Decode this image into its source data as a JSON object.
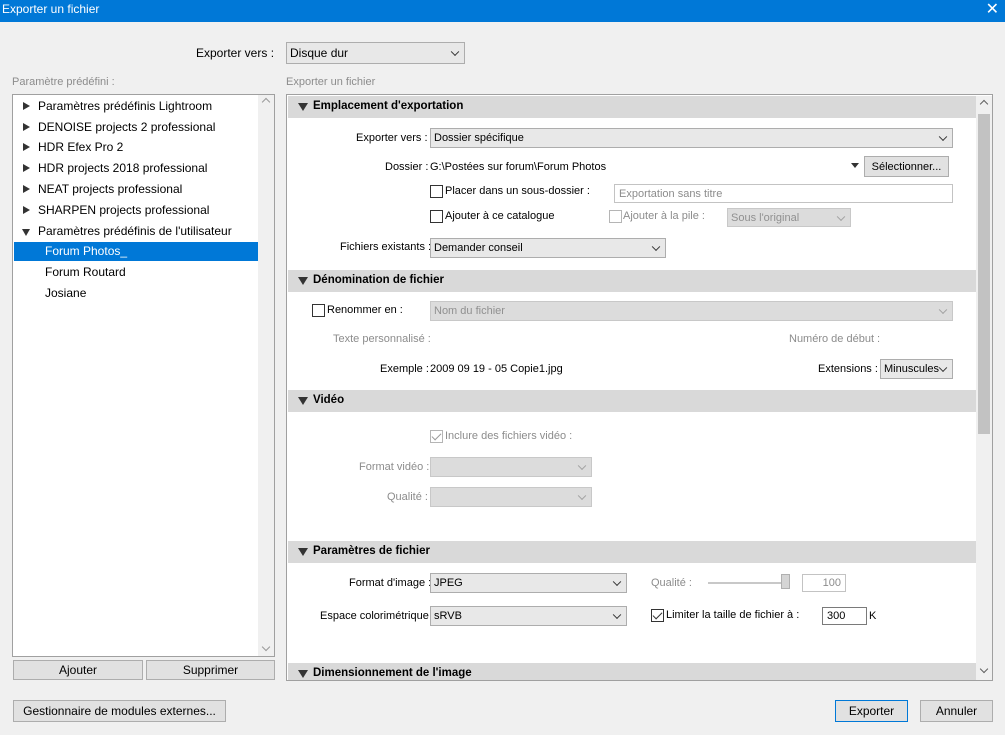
{
  "window": {
    "title": "Exporter un fichier",
    "close": "✕"
  },
  "top": {
    "export_to_label": "Exporter vers :",
    "export_to_value": "Disque dur"
  },
  "left": {
    "header": "Paramètre prédéfini :",
    "presets": [
      "Paramètres prédéfinis Lightroom",
      "DENOISE projects 2 professional",
      "HDR Efex Pro 2",
      "HDR projects 2018 professional",
      "NEAT projects professional",
      "SHARPEN projects professional",
      "Paramètres prédéfinis de l'utilisateur"
    ],
    "user_presets": [
      "Forum Photos_",
      "Forum Routard",
      "Josiane"
    ],
    "add_button": "Ajouter",
    "remove_button": "Supprimer"
  },
  "right": {
    "header": "Exporter un fichier",
    "location": {
      "title": "Emplacement d'exportation",
      "export_to_label": "Exporter vers :",
      "export_to_value": "Dossier spécifique",
      "folder_label": "Dossier :",
      "folder_value": "G:\\Postées sur forum\\Forum Photos",
      "select_button": "Sélectionner...",
      "subfolder_label": "Placer dans un sous-dossier :",
      "subfolder_placeholder": "Exportation sans titre",
      "add_catalog_label": "Ajouter à ce catalogue",
      "add_stack_label": "Ajouter à la pile :",
      "stack_value": "Sous l'original",
      "existing_label": "Fichiers existants :",
      "existing_value": "Demander conseil"
    },
    "naming": {
      "title": "Dénomination de fichier",
      "rename_label": "Renommer en :",
      "rename_value": "Nom du fichier",
      "custom_text_label": "Texte personnalisé :",
      "start_number_label": "Numéro de début :",
      "example_label": "Exemple :",
      "example_value": "2009 09 19 - 05 Copie1.jpg",
      "extensions_label": "Extensions :",
      "extensions_value": "Minuscules"
    },
    "video": {
      "title": "Vidéo",
      "include_label": "Inclure des fichiers vidéo :",
      "format_label": "Format vidéo :",
      "quality_label": "Qualité :"
    },
    "file_settings": {
      "title": "Paramètres de fichier",
      "format_label": "Format d'image :",
      "format_value": "JPEG",
      "quality_label": "Qualité :",
      "quality_value": "100",
      "colorspace_label": "Espace colorimétrique :",
      "colorspace_value": "sRVB",
      "limit_label": "Limiter la taille de fichier à :",
      "limit_value": "300",
      "limit_unit": "K"
    },
    "sizing": {
      "title": "Dimensionnement de l'image"
    }
  },
  "bottom": {
    "plugin_manager": "Gestionnaire de modules externes...",
    "export": "Exporter",
    "cancel": "Annuler"
  }
}
